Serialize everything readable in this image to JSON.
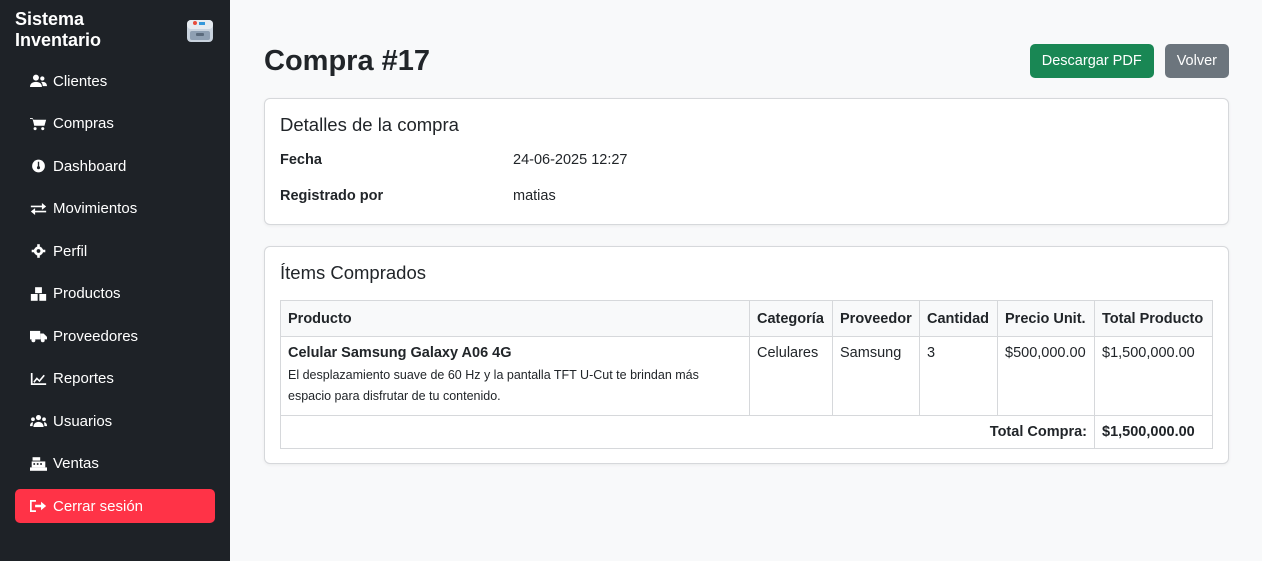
{
  "sidebar": {
    "brand": "Sistema Inventario",
    "items": [
      {
        "label": "Clientes",
        "icon": "users-icon"
      },
      {
        "label": "Compras",
        "icon": "cart-icon"
      },
      {
        "label": "Dashboard",
        "icon": "gauge-icon"
      },
      {
        "label": "Movimientos",
        "icon": "exchange-icon"
      },
      {
        "label": "Perfil",
        "icon": "gear-icon"
      },
      {
        "label": "Productos",
        "icon": "boxes-icon"
      },
      {
        "label": "Proveedores",
        "icon": "truck-icon"
      },
      {
        "label": "Reportes",
        "icon": "chart-line-icon"
      },
      {
        "label": "Usuarios",
        "icon": "users-group-icon"
      },
      {
        "label": "Ventas",
        "icon": "cash-register-icon"
      }
    ],
    "logout": "Cerrar sesión"
  },
  "header": {
    "title": "Compra #17",
    "pdf_button": "Descargar PDF",
    "back_button": "Volver"
  },
  "details": {
    "title": "Detalles de la compra",
    "fecha_label": "Fecha",
    "fecha_value": "24-06-2025 12:27",
    "registrado_label": "Registrado por",
    "registrado_value": "matias"
  },
  "items": {
    "title": "Ítems Comprados",
    "columns": [
      "Producto",
      "Categoría",
      "Proveedor",
      "Cantidad",
      "Precio Unit.",
      "Total Producto"
    ],
    "rows": [
      {
        "name": "Celular Samsung Galaxy A06 4G",
        "description": "El desplazamiento suave de 60 Hz y la pantalla TFT U-Cut te brindan más espacio para disfrutar de tu contenido.",
        "category": "Celulares",
        "supplier": "Samsung",
        "quantity": "3",
        "unit_price": "$500,000.00",
        "total": "$1,500,000.00"
      }
    ],
    "total_label": "Total Compra:",
    "total_value": "$1,500,000.00"
  },
  "colors": {
    "sidebar_bg": "#1e2227",
    "logout_bg": "#ff3347",
    "success": "#198754",
    "secondary": "#6c757d"
  }
}
